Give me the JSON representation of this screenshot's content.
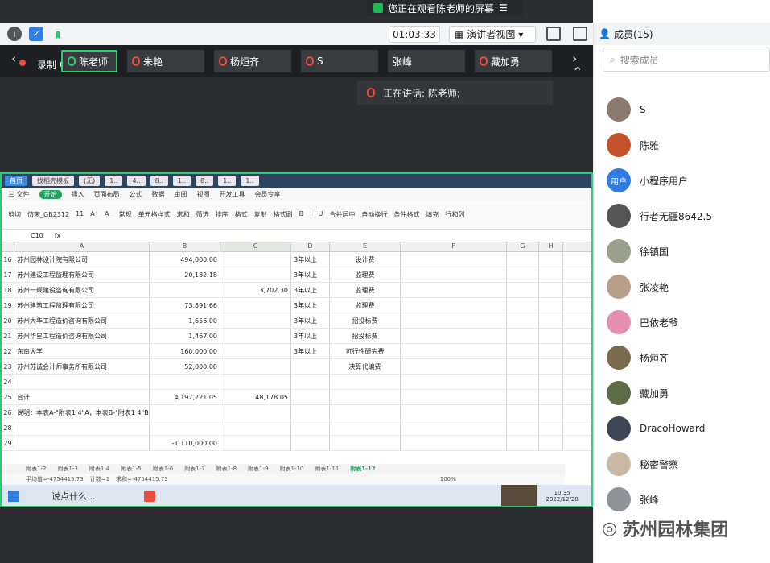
{
  "share_banner": {
    "text": "您正在观看陈老师的屏幕",
    "menu_icon": "menu-icon"
  },
  "topbar": {
    "timer": "01:03:33",
    "view_label": "演讲者视图",
    "view_caret": "▾"
  },
  "tiles": [
    {
      "name": "陈老师",
      "prefix": "录制 中"
    },
    {
      "name": "朱艳"
    },
    {
      "name": "杨烜齐"
    },
    {
      "name": "S"
    },
    {
      "name": "张峰"
    },
    {
      "name": "藏加勇"
    }
  ],
  "speaking": {
    "text": "正在讲话: 陈老师;"
  },
  "spreadsheet": {
    "tabs": [
      "首页",
      "找稻壳模板",
      "(无)",
      "1..",
      "4..",
      "8..",
      "1..",
      "8..",
      "1..",
      "1.."
    ],
    "menu": [
      "三 文件",
      "开始",
      "插入",
      "页面布局",
      "公式",
      "数据",
      "审阅",
      "视图",
      "开发工具",
      "会员专享"
    ],
    "ribbon": [
      "剪切",
      "仿宋_GB2312",
      "11",
      "A⁺",
      "A⁻",
      "常规",
      "单元格样式",
      "求和",
      "筛选",
      "排序",
      "格式",
      "复制",
      "格式刷",
      "B",
      "I",
      "U",
      "合并居中",
      "自动换行",
      "条件格式",
      "填充",
      "行和列"
    ],
    "cell_ref": "C10",
    "fx": "fx",
    "columns": [
      "A",
      "B",
      "C",
      "D",
      "E",
      "F",
      "G",
      "H"
    ],
    "rows": [
      {
        "n": "16",
        "a": "苏州园林设计院有限公司",
        "b": "494,000.00",
        "c": "",
        "d": "3年以上",
        "e": "设计费"
      },
      {
        "n": "17",
        "a": "苏州建设工程监理有限公司",
        "b": "20,182.18",
        "c": "",
        "d": "3年以上",
        "e": "监理费"
      },
      {
        "n": "18",
        "a": "苏州一规建设咨询有限公司",
        "b": "",
        "c": "3,702.30",
        "d": "3年以上",
        "e": "监理费"
      },
      {
        "n": "19",
        "a": "苏州建筑工程监理有限公司",
        "b": "73,891.66",
        "c": "",
        "d": "3年以上",
        "e": "监理费"
      },
      {
        "n": "20",
        "a": "苏州大华工程造价咨询有限公司",
        "b": "1,656.00",
        "c": "",
        "d": "3年以上",
        "e": "招投标费"
      },
      {
        "n": "21",
        "a": "苏州华星工程造价咨询有限公司",
        "b": "1,467.00",
        "c": "",
        "d": "3年以上",
        "e": "招投标费"
      },
      {
        "n": "22",
        "a": "东南大学",
        "b": "160,000.00",
        "c": "",
        "d": "3年以上",
        "e": "可行性研究费"
      },
      {
        "n": "23",
        "a": "苏州苏诚会计师事务所有限公司",
        "b": "52,000.00",
        "c": "",
        "d": "",
        "e": "决算代编费"
      },
      {
        "n": "24",
        "a": "",
        "b": "",
        "c": "",
        "d": "",
        "e": ""
      },
      {
        "n": "25",
        "a": "合计",
        "b": "4,197,221.05",
        "c": "48,178.05",
        "d": "",
        "e": ""
      },
      {
        "n": "26",
        "a": "说明：本表A-\"附表1 4\"A，本表B-\"附表1 4\"B。",
        "b": "",
        "c": "",
        "d": "",
        "e": ""
      },
      {
        "n": "28",
        "a": "",
        "b": "",
        "c": "",
        "d": "",
        "e": ""
      },
      {
        "n": "29",
        "a": "",
        "b": "-1,110,000.00",
        "c": "",
        "d": "",
        "e": ""
      }
    ],
    "sheets": [
      "附表1-2",
      "附表1-3",
      "附表1-4",
      "附表1-5",
      "附表1-6",
      "附表1-7",
      "附表1-8",
      "附表1-9",
      "附表1-10",
      "附表1-11",
      "附表1-12"
    ],
    "status": [
      "平均值=-4754415.73",
      "计数=1",
      "求和=-4754415.73",
      "100%"
    ],
    "taskbar": {
      "chat_placeholder": "说点什么...",
      "time": "10:35",
      "date": "2022/12/28"
    }
  },
  "sidebar": {
    "header": "成员(15)",
    "search_placeholder": "搜索成员",
    "members": [
      {
        "name": "S",
        "color": "#8a7b6e"
      },
      {
        "name": "陈雅",
        "color": "#c4532e"
      },
      {
        "name": "小程序用户",
        "color": "#2f7de1",
        "avatar_text": "用户"
      },
      {
        "name": "行者无疆8642.5",
        "color": "#555555"
      },
      {
        "name": "徐镇国",
        "color": "#9aa08c"
      },
      {
        "name": "张凌艳",
        "color": "#b89f8a"
      },
      {
        "name": "巴依老爷",
        "color": "#e58fb0"
      },
      {
        "name": "杨烜齐",
        "color": "#7a6a4e"
      },
      {
        "name": "藏加勇",
        "color": "#5d6e46"
      },
      {
        "name": "DracoHoward",
        "color": "#3d4654"
      },
      {
        "name": "秘密警察",
        "color": "#c9b9a4"
      },
      {
        "name": "张峰",
        "color": "#8e9398"
      }
    ]
  },
  "watermark": "苏州园林集团"
}
